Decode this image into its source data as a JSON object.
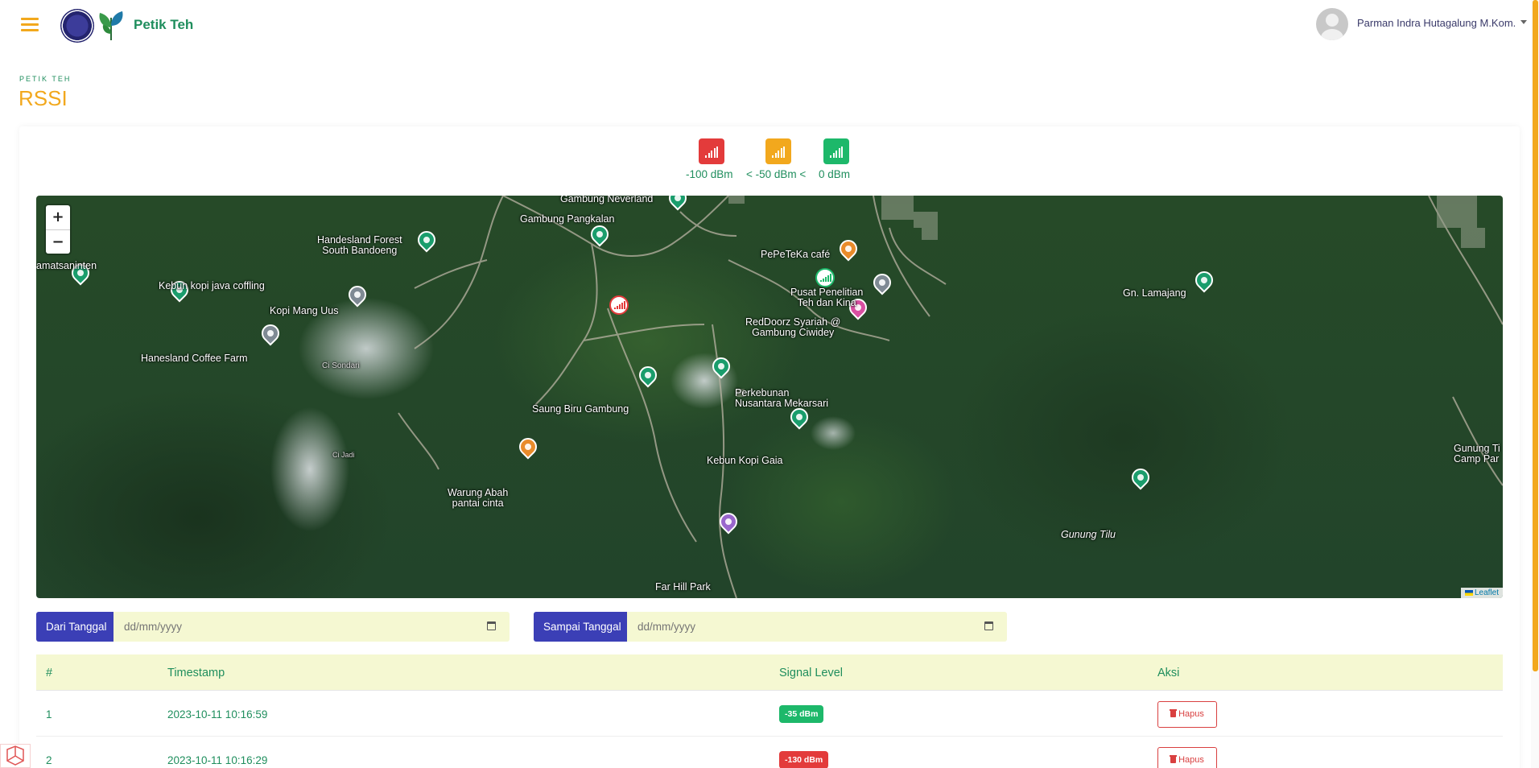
{
  "app": {
    "name": "Petik Teh"
  },
  "user": {
    "name": "Parman Indra Hutagalung M.Kom."
  },
  "page": {
    "breadcrumb": "PETIK TEH",
    "title": "RSSI"
  },
  "legend": {
    "items": [
      {
        "color": "#e33b3b",
        "icon": "signal-bars-icon"
      },
      {
        "color": "#f2a81d",
        "icon": "signal-bars-icon"
      },
      {
        "color": "#1db86a",
        "icon": "signal-bars-icon"
      }
    ],
    "labels": [
      "-100 dBm",
      "< -50 dBm <",
      "0 dBm"
    ]
  },
  "map": {
    "zoom_in": "+",
    "zoom_out": "−",
    "attribution": "Leaflet",
    "labels": {
      "gambung_neverland": "Gambung Neverland",
      "gambung_pangkalan": "Gambung Pangkalan",
      "handesland_forest": "Handesland Forest",
      "south_bandoeng": "South Bandoeng",
      "amatsaninten": "amatsaninten",
      "kebun_kopi_java": "Kebun kopi java coffling",
      "kopi_mang_uus": "Kopi Mang Uus",
      "hanesland_coffee": "Hanesland Coffee Farm",
      "pepeteka_cafe": "PePeTeKa café",
      "pusat_penelitian_1": "Pusat Penelitian",
      "pusat_penelitian_2": "Teh dan Kina",
      "reddoorz_1": "RedDoorz Syariah @",
      "reddoorz_2": "Gambung Ciwidey",
      "gn_lamajang": "Gn. Lamajang",
      "perkebunan_1": "Perkebunan",
      "perkebunan_2": "Nusantara Mekarsari",
      "saung_biru": "Saung Biru Gambung",
      "kebun_kopi_gaia": "Kebun Kopi Gaia",
      "warung_abah_1": "Warung Abah",
      "warung_abah_2": "pantai cinta",
      "gunung_tilu": "Gunung Tilu",
      "gunung_ti_1": "Gunung Ti",
      "gunung_ti_2": "Camp Par",
      "far_hill_park": "Far Hill Park",
      "cisondari": "Ci Sondari",
      "ci_jadi": "Ci Jadi"
    },
    "markers": [
      {
        "signal": "bad",
        "color": "#e33b3b"
      },
      {
        "signal": "good",
        "color": "#1db86a"
      }
    ]
  },
  "filters": {
    "from_label": "Dari Tanggal",
    "from_placeholder": "dd/mm/yyyy",
    "to_label": "Sampai Tanggal",
    "to_placeholder": "dd/mm/yyyy"
  },
  "table": {
    "headers": [
      "#",
      "Timestamp",
      "Signal Level",
      "Aksi"
    ],
    "rows": [
      {
        "no": "1",
        "timestamp": "2023-10-11 10:16:59",
        "signal": "-35 dBm",
        "status": "good",
        "action": "Hapus"
      },
      {
        "no": "2",
        "timestamp": "2023-10-11 10:16:29",
        "signal": "-130 dBm",
        "status": "bad",
        "action": "Hapus"
      }
    ]
  }
}
